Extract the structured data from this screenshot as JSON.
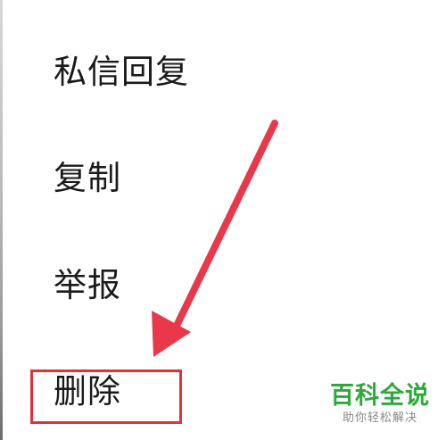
{
  "menu": {
    "items": [
      {
        "label": "私信回复"
      },
      {
        "label": "复制"
      },
      {
        "label": "举报"
      },
      {
        "label": "删除"
      }
    ]
  },
  "annotation": {
    "arrow_color": "#e8384a",
    "highlight_color": "#e0323c",
    "highlighted_item": "删除"
  },
  "watermark": {
    "title": "百科全说",
    "subtitle": "助你轻松解决",
    "color": "#2fa83b"
  }
}
